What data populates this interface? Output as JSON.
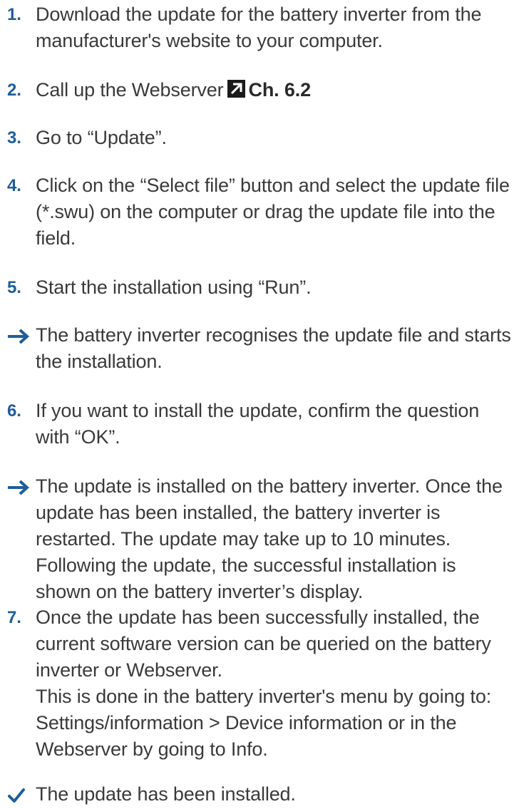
{
  "steps": [
    {
      "marker": "1.",
      "text": "Download the update for the battery inverter from the manufacturer's website to your computer."
    },
    {
      "marker": "2.",
      "text": "Call up the Webserver",
      "ref": "Ch. 6.2"
    },
    {
      "marker": "3.",
      "text": "Go to “Update”."
    },
    {
      "marker": "4.",
      "text": "Click on the “Select file” button and select the update file (*.swu) on the computer or drag the update file into the field."
    },
    {
      "marker": "5.",
      "text": "Start the installation using “Run”."
    },
    {
      "marker": "arrow",
      "text": "The battery inverter recognises the update file and starts the installation."
    },
    {
      "marker": "6.",
      "text": "If you want to install the update, confirm the question with “OK”."
    },
    {
      "marker": "arrow",
      "text": "The update is installed on the battery inverter. Once the update has been installed, the battery inverter is restarted. The update may take up to 10 minutes. Following the update, the successful installation is shown on the battery inverter’s display."
    },
    {
      "marker": "7.",
      "text": "Once the update has been successfully installed, the current software version can be queried on the battery inverter or Webserver.",
      "text2": "This is done in the battery inverter's menu by going to: Settings/information > Device information or in the Webserver by going to Info."
    },
    {
      "marker": "check",
      "text": "The update has been installed."
    }
  ],
  "colors": {
    "accent": "#1f5d99",
    "text": "#3a3a3a"
  },
  "icons": {
    "arrow": "right-arrow-icon",
    "check": "checkmark-icon",
    "link": "external-link-icon"
  }
}
